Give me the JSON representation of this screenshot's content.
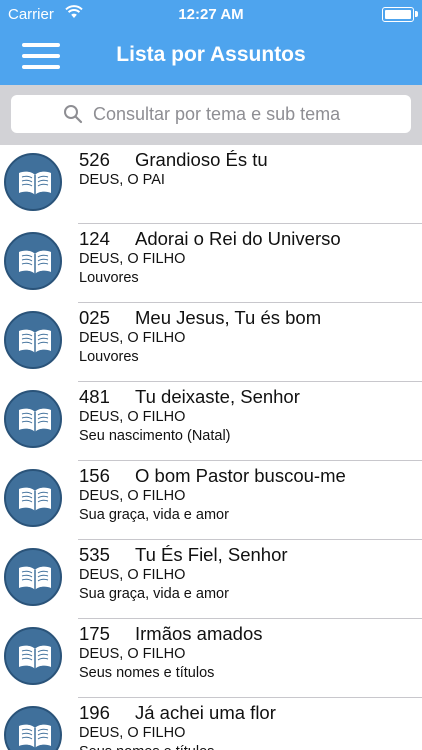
{
  "status_bar": {
    "carrier": "Carrier",
    "time": "12:27 AM"
  },
  "nav": {
    "title": "Lista por Assuntos",
    "menu_icon": "hamburger-menu-icon"
  },
  "search": {
    "placeholder": "Consultar por tema e sub tema",
    "icon": "search-icon"
  },
  "colors": {
    "nav_background": "#4ea4ee",
    "avatar": "#40709b",
    "search_background": "#d2d2d6"
  },
  "hymns": [
    {
      "number": "526",
      "title": "Grandioso És tu",
      "topic": "DEUS, O PAI",
      "subtopic": ""
    },
    {
      "number": "124",
      "title": "Adorai o Rei do Universo",
      "topic": "DEUS, O FILHO",
      "subtopic": "Louvores"
    },
    {
      "number": "025",
      "title": "Meu Jesus, Tu és bom",
      "topic": "DEUS, O FILHO",
      "subtopic": "Louvores"
    },
    {
      "number": "481",
      "title": "Tu deixaste, Senhor",
      "topic": "DEUS, O FILHO",
      "subtopic": "Seu nascimento (Natal)"
    },
    {
      "number": "156",
      "title": "O bom Pastor buscou-me",
      "topic": "DEUS, O FILHO",
      "subtopic": "Sua graça, vida e amor"
    },
    {
      "number": "535",
      "title": "Tu És Fiel, Senhor",
      "topic": "DEUS, O FILHO",
      "subtopic": "Sua graça, vida e amor"
    },
    {
      "number": "175",
      "title": "Irmãos amados",
      "topic": "DEUS, O FILHO",
      "subtopic": "Seus nomes e títulos"
    },
    {
      "number": "196",
      "title": "Já achei uma flor",
      "topic": "DEUS, O FILHO",
      "subtopic": "Seus nomes e títulos"
    }
  ]
}
